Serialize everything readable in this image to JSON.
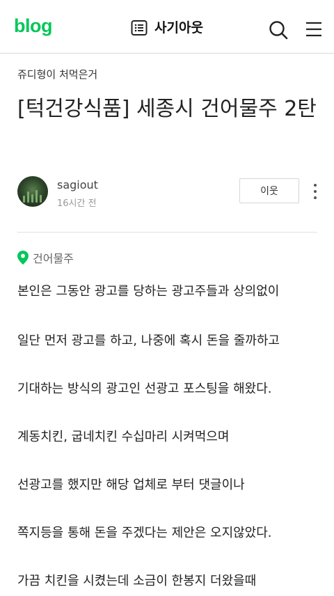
{
  "header": {
    "logo": "blog",
    "blog_title": "사기아웃",
    "icons": {
      "list": "list-icon",
      "search": "search-icon",
      "menu": "hamburger-menu-icon"
    }
  },
  "post": {
    "category": "쥬디형이 처먹은거",
    "title": "[턱건강식품] 세종시 건어물주 2탄",
    "author": "sagiout",
    "posted_time": "16시간 전",
    "neighbor_button": "이웃",
    "location": "건어물주",
    "body_lines": [
      "본인은 그동안 광고를 당하는 광고주들과 상의없이",
      "일단 먼저 광고를 하고, 나중에 혹시 돈을 줄까하고",
      "기대하는 방식의 광고인 선광고 포스팅을 해왔다.",
      "계동치킨, 굽네치킨 수십마리 시켜먹으며",
      "선광고를 했지만 해당 업체로 부터 댓글이나",
      "쪽지등을 통해 돈을 주겠다는 제안은 오지않았다.",
      "가끔 치킨을 시켰는데 소금이 한봉지 더왔을때"
    ]
  },
  "colors": {
    "brand": "#03c75a",
    "location_pin": "#03c75a"
  }
}
